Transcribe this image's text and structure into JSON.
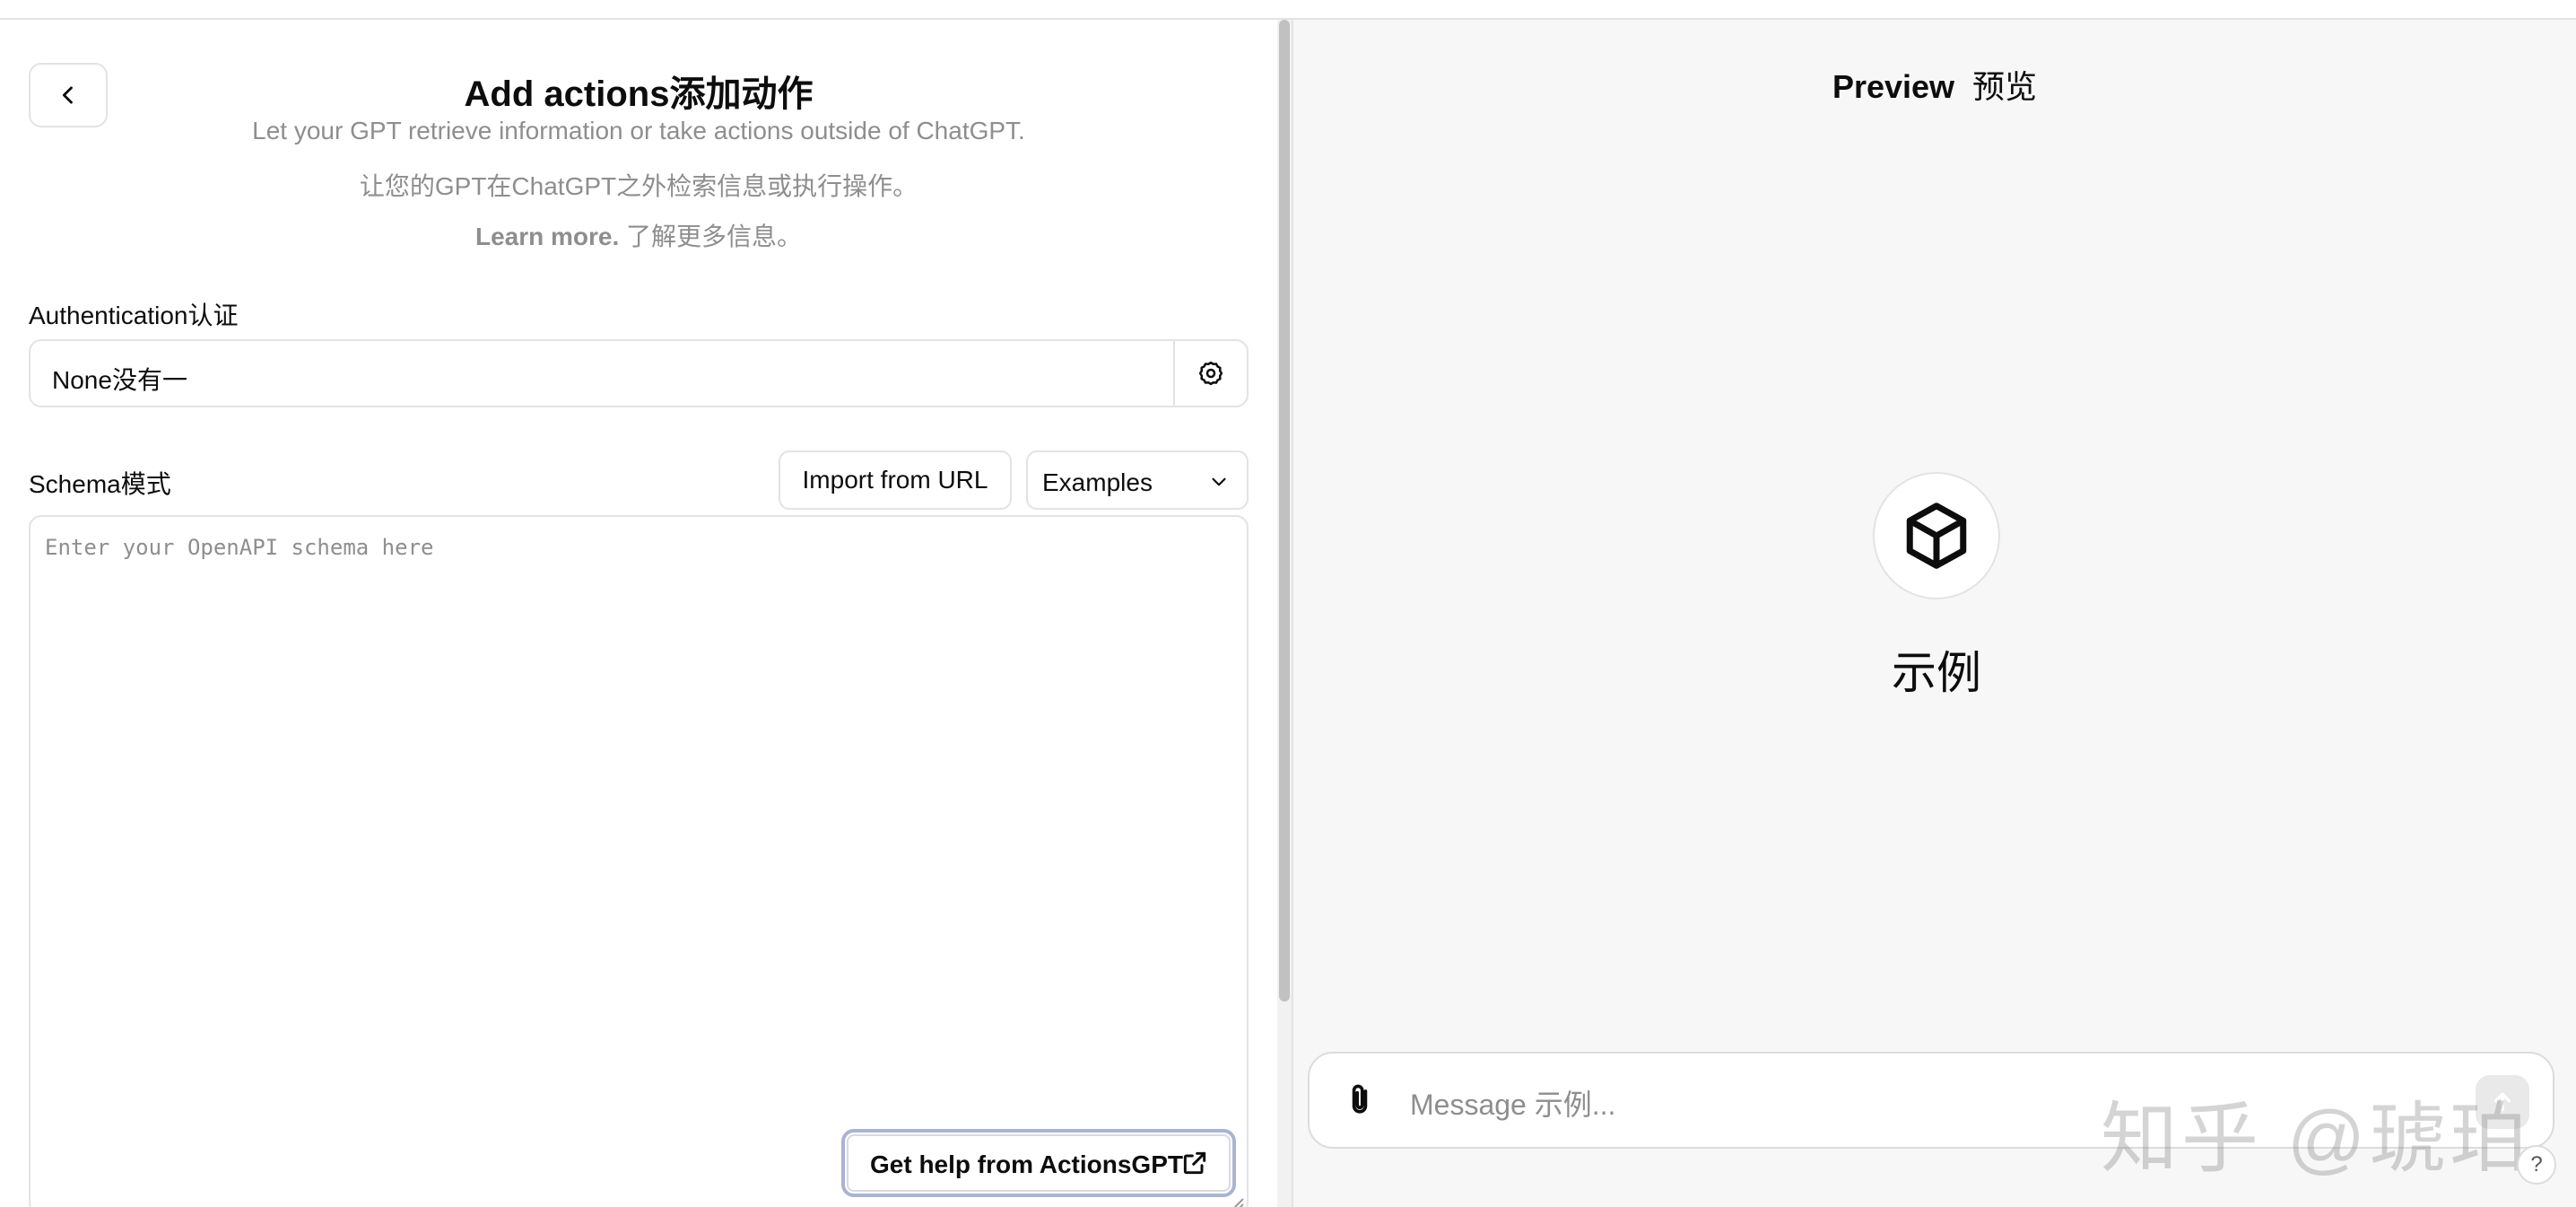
{
  "builder": {
    "title": "Add actions添加动作",
    "subtitle_en": "Let your GPT retrieve information or take actions outside of ChatGPT.",
    "subtitle_zh": "让您的GPT在ChatGPT之外检索信息或执行操作。",
    "learn_more_link": "Learn more.",
    "learn_more_zh": " 了解更多信息。",
    "authentication": {
      "label": "Authentication认证",
      "value": "None没有一"
    },
    "schema": {
      "label": "Schema模式",
      "import_button": "Import from URL",
      "examples_select": "Examples",
      "placeholder": "Enter your OpenAPI schema here"
    },
    "help_button": "Get help from ActionsGPT"
  },
  "preview": {
    "title_en": "Preview",
    "title_zh": "预览",
    "gpt_name": "示例",
    "composer_placeholder": "Message 示例...",
    "watermark": "知乎 @琥珀",
    "help_glyph": "?"
  }
}
